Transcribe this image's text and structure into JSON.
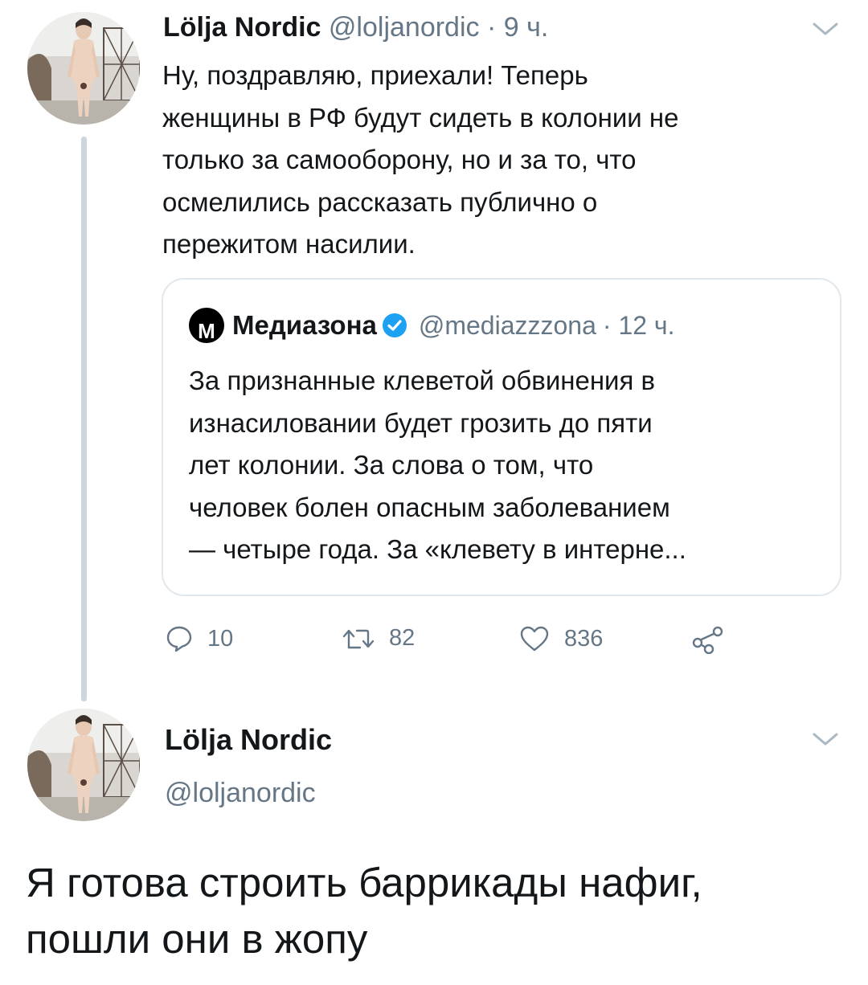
{
  "tweet": {
    "author_name": "Lölja Nordic",
    "author_handle": "@loljanordic",
    "time": "· 9 ч.",
    "text_lines": [
      "Ну, поздравляю, приехали! Теперь",
      "женщины в РФ будут сидеть в колонии не",
      "только за самооборону, но и за то, что",
      "осмелились рассказать публично о",
      "пережитом насилии."
    ],
    "quote": {
      "logo_letter": "М",
      "author_name": "Медиазона",
      "author_handle": "@mediazzzona",
      "time": "· 12 ч.",
      "text_lines": [
        "За признанные клеветой обвинения в",
        "изнасиловании будет грозить до пяти",
        "лет колонии. За слова о том, что",
        "человек болен опасным заболеванием",
        "— четыре года. За «клевету в интерне..."
      ]
    },
    "actions": {
      "replies": "10",
      "retweets": "82",
      "likes": "836"
    }
  },
  "reply": {
    "author_name": "Lölja Nordic",
    "author_handle": "@loljanordic",
    "text_lines": [
      "Я готова строить баррикады нафиг,",
      "пошли они в жопу"
    ]
  },
  "colors": {
    "text": "#14171a",
    "muted": "#657786",
    "border": "#e1e8ed",
    "thread_line": "#ccd6dd",
    "verified": "#1da1f2"
  },
  "icons": [
    "avatar-photo",
    "chevron-down-icon",
    "verified-badge-icon",
    "reply-icon",
    "retweet-icon",
    "like-icon",
    "share-icon"
  ]
}
